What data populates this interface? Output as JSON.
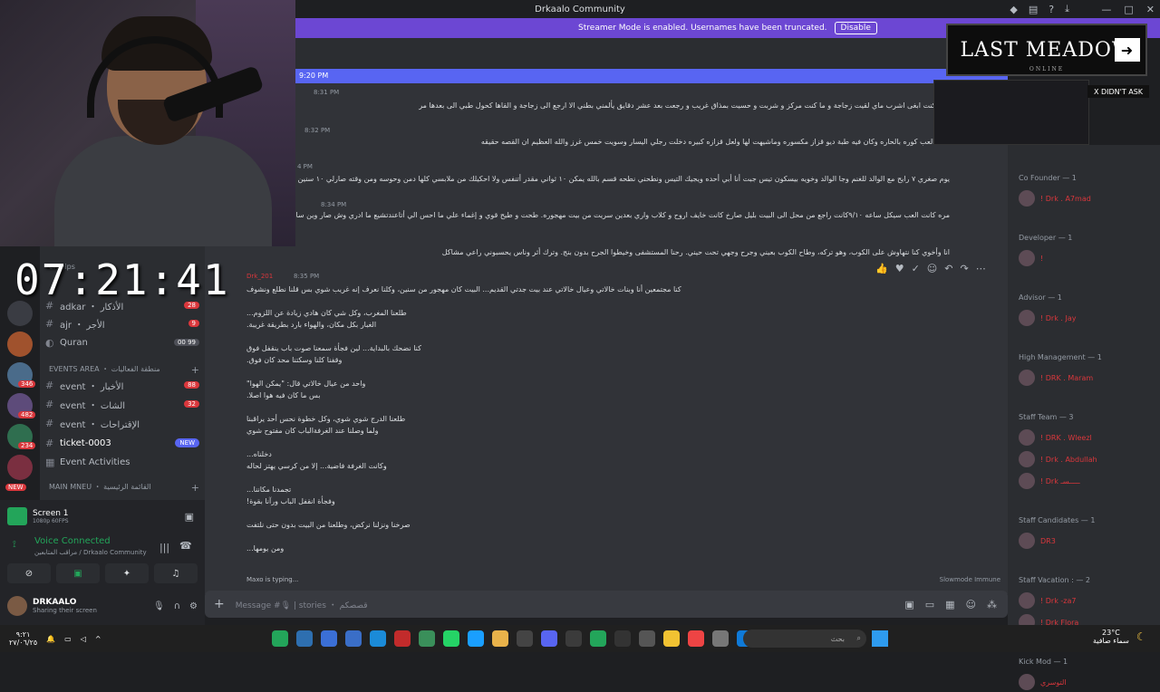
{
  "window": {
    "title": "Drkaalo Community"
  },
  "banner": {
    "text": "Streamer Mode is enabled. Usernames have been truncated.",
    "button": "Disable"
  },
  "stream": {
    "clock": "07:21:41"
  },
  "channels": {
    "partial_header": "erships",
    "rows": [
      {
        "label": "adkar ・ الأذكار",
        "badge": "28",
        "icon": "hash-icon"
      },
      {
        "label": "ajr ・ الأجر",
        "badge": "9",
        "icon": "hash-icon"
      },
      {
        "label": "Quran",
        "badge": "00 99",
        "icon": "speaker-icon"
      }
    ],
    "events_category": "EVENTS AREA ・ منطقة الفعاليات",
    "event_rows": [
      {
        "label": "event ・ الأخبار",
        "badge": "88"
      },
      {
        "label": "event ・ الشات",
        "badge": "32"
      },
      {
        "label": "event ・ الإقتراحات",
        "badge": ""
      },
      {
        "label": "ticket-0003",
        "badge": "NEW"
      },
      {
        "label": "Event Activities",
        "badge": ""
      }
    ],
    "main_category": "MAIN MNEU ・ القائمة الرئيسية"
  },
  "server_badges": [
    "346",
    "482",
    "234",
    "NEW"
  ],
  "voice": {
    "screen_title": "Screen 1",
    "screen_sub": "1080p 60FPS",
    "status": "Voice Connected",
    "channel": "مراقب المتابعين / Drkaalo Community",
    "user_name": "DRKAALO",
    "user_status": "Sharing their screen"
  },
  "chat": {
    "new_marker": "9:20 PM",
    "messages": [
      {
        "time": "8:31 PM",
        "text": "مره كنت ابغى اشرب ماي لقيت زجاجة و ما كنت مركز و شربت و حسيت بمذاق غريب و رجعت بعد عشر دقايق يألمني بطني الا ارجع الى زجاجة و القاها كحول طبي الى بعدها مر"
      },
      {
        "time": "8:32 PM",
        "text": "كنت العب كوره بالحاره وكان فيه طبة ديو قزاز مكسوره وماشيهت لها ولعل قزازه كبيره دخلت رجلي اليسار وسويت خمس غرز والله العظيم ان القصه حقيقه"
      },
      {
        "time": "4 PM",
        "text": "يوم صغري ٧ رايح مع الوالد للغنم وجا الوالد وخويه بيسكون تيس جبت أنا أبي أحده ويجيك التيس ونطحني نطحه قسم بالله يمكن ١٠ ثواني مقدر أتنفس ولا احكيلك من ملابسي كلها دمن وحوسه ومن وقته صارلي ١٠ سنين مارحت مع"
      },
      {
        "time": "8:34 PM",
        "text": "مره كانت العب سيكل ساعه ٩/١٠كانت راجع من محل الى البيت بليل صارخ كانت خايف اروح و كلاب واري بعدين سريت من بيت مهجوره. طحت و طيح قوي و إغماء علي ما احس الي أتاعندتشيع ما ادري وش صار وين سالفة في"
      },
      {
        "time": "",
        "text": "انا وأخوي كنا نتهاوش على الكوب، وهو تركه، وطاح الكوب بعيني وجرح وجهي تحت حيني. رحنا المستشفى وخيطوا الجرح بدون بنج. وترك أثر وناس يحسبوني راعي مشاكل"
      }
    ],
    "post_author": "Drk_201",
    "post_time": "8:35 PM",
    "post_lines": [
      "كنا مجتمعين أنا وبنات خالاتي وعيال خالاتي عند بيت جدتي القديم... البيت كان مهجور من سنين، وكلنا نعرف إنه غريب شوي بس قلنا نطلع ونشوف",
      "",
      "طلعنا المغرب، وكل شي كان هادي زيادة عن اللزوم...",
      "الغبار بكل مكان، والهواء بارد بطريقة غريبة.",
      "",
      "كنا نضحك بالبداية... لين فجأة سمعنا صوت باب ينقفل فوق",
      "وقفنا كلنا وسكتنا محد كان فوق.",
      "",
      "واحد من عيال خالاتي قال: \"يمكن الهوا\"",
      "بس ما كان فيه هوا اصلا.",
      "",
      "طلعنا الدرج شوي شوي، وكل خطوة نحس أحد يراقبنا",
      "ولما وصلنا عند الغرفةالباب كان مفتوح شوي",
      "",
      "دخلناه...",
      "وكانت الغرفة فاضية... إلا من كرسي يهتز لحاله",
      "",
      "تجمدنا مكاننا...",
      "وفجأة انقفل الباب ورآنا بقوة!",
      "",
      "صرخنا ونزلنا نركض، وطلعنا من البيت بدون حتى نلتفت",
      "",
      "ومن يومها..."
    ],
    "typing": "Maxo is typing...",
    "slowmode": "Slowmode Immune",
    "input_placeholder": "Message #🎙 | stories ・ قصصكم"
  },
  "members": {
    "groups": [
      {
        "role": "Co Founder — 1",
        "names": [
          "! Drk . A7mad"
        ]
      },
      {
        "role": "Developer — 1",
        "names": [
          "!"
        ]
      },
      {
        "role": "Advisor — 1",
        "names": [
          "! Drk . Jay"
        ]
      },
      {
        "role": "High Management — 1",
        "names": [
          "! DRK . Maram"
        ]
      },
      {
        "role": "Staff Team — 3",
        "names": [
          "! DRK . Wleezl",
          "! Drk . Abdullah",
          "! Drk ـــــسـ"
        ]
      },
      {
        "role": "Staff Candidates — 1",
        "names": [
          "DR3"
        ]
      },
      {
        "role": "Staff Vacation : — 2",
        "names": [
          "! Drk -za7",
          "! Drk Flora"
        ]
      },
      {
        "role": "Kick Mod — 1",
        "names": [
          "التوسري"
        ]
      }
    ]
  },
  "overlay": {
    "game_title": "LAST MEADOW",
    "game_sub": "ONLINE",
    "didnt_ask": "X DIDN'T ASK"
  },
  "taskbar": {
    "time": "٩:٢١",
    "date": "٢٧/٠٦/٢٥",
    "search_placeholder": "بحث",
    "temp": "23°C",
    "weather": "سماء صافية"
  },
  "colors": {
    "accent": "#5865f2",
    "banner": "#6c47d3",
    "online": "#23a55a",
    "badge": "#da373c"
  }
}
